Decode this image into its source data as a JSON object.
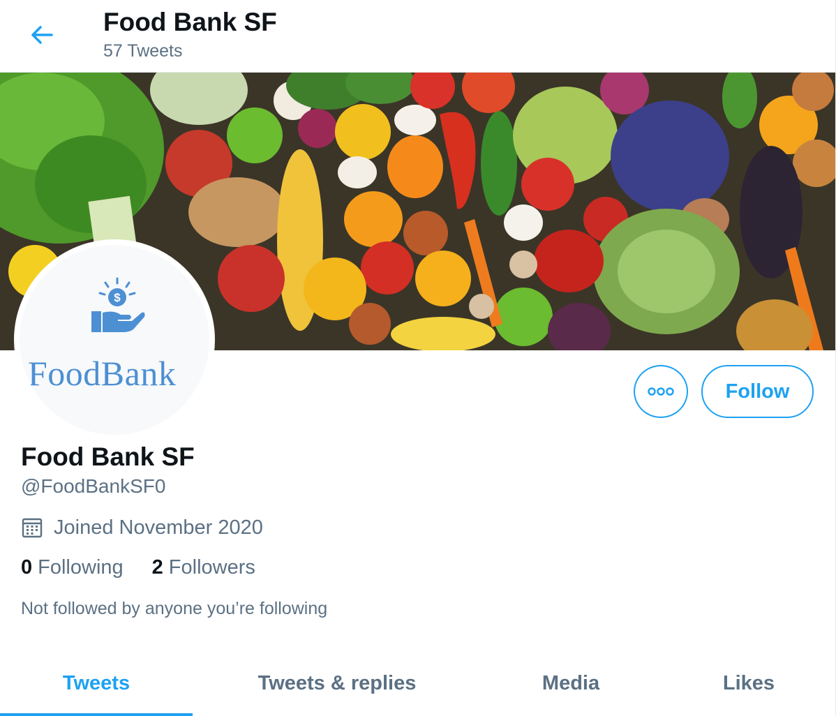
{
  "header": {
    "title": "Food Bank SF",
    "tweet_count": "57 Tweets"
  },
  "avatar": {
    "logo_text": "FoodBank",
    "logo_color": "#4d8fd3"
  },
  "actions": {
    "follow_label": "Follow"
  },
  "profile": {
    "name": "Food Bank SF",
    "handle": "@FoodBankSF0",
    "joined": "Joined November 2020",
    "following_count": "0",
    "following_label": "Following",
    "followers_count": "2",
    "followers_label": "Followers",
    "followed_by": "Not followed by anyone you’re following"
  },
  "tabs": [
    {
      "label": "Tweets",
      "active": true
    },
    {
      "label": "Tweets & replies",
      "active": false
    },
    {
      "label": "Media",
      "active": false
    },
    {
      "label": "Likes",
      "active": false
    }
  ],
  "colors": {
    "accent": "#1da1f2",
    "text": "#0f1419",
    "secondary": "#5b7083"
  }
}
